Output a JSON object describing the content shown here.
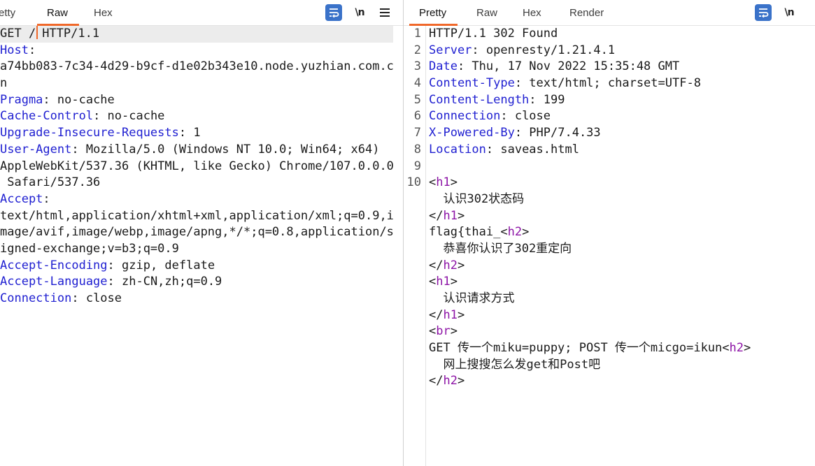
{
  "request": {
    "tabs": [
      "Pretty",
      "Raw",
      "Hex"
    ],
    "active_tab": "Raw",
    "tools": {
      "newline_label": "\\n"
    },
    "request_line": {
      "method": "GET /",
      "rest": "HTTP/1.1"
    },
    "lines": [
      {
        "k": "Host",
        "v": ":"
      },
      {
        "k": "",
        "v": "a74bb083-7c34-4d29-b9cf-d1e02b343e10.node.yuzhian.com.c"
      },
      {
        "k": "",
        "v": "n"
      },
      {
        "k": "Pragma",
        "v": ": no-cache"
      },
      {
        "k": "Cache-Control",
        "v": ": no-cache"
      },
      {
        "k": "Upgrade-Insecure-Requests",
        "v": ": 1"
      },
      {
        "k": "User-Agent",
        "v": ": Mozilla/5.0 (Windows NT 10.0; Win64; x64)"
      },
      {
        "k": "",
        "v": "AppleWebKit/537.36 (KHTML, like Gecko) Chrome/107.0.0.0"
      },
      {
        "k": "",
        "v": " Safari/537.36"
      },
      {
        "k": "Accept",
        "v": ":"
      },
      {
        "k": "",
        "v": "text/html,application/xhtml+xml,application/xml;q=0.9,i"
      },
      {
        "k": "",
        "v": "mage/avif,image/webp,image/apng,*/*;q=0.8,application/s"
      },
      {
        "k": "",
        "v": "igned-exchange;v=b3;q=0.9"
      },
      {
        "k": "Accept-Encoding",
        "v": ": gzip, deflate"
      },
      {
        "k": "Accept-Language",
        "v": ": zh-CN,zh;q=0.9"
      },
      {
        "k": "Connection",
        "v": ": close"
      }
    ]
  },
  "response": {
    "tabs": [
      "Pretty",
      "Raw",
      "Hex",
      "Render"
    ],
    "active_tab": "Pretty",
    "tools": {
      "newline_label": "\\n"
    },
    "line_numbers": [
      "1",
      "2",
      "3",
      "4",
      "5",
      "6",
      "7",
      "8",
      "9",
      "10"
    ],
    "lines": [
      [
        {
          "c": "",
          "s": "HTTP/1.1 302 Found"
        }
      ],
      [
        {
          "c": "k",
          "s": "Server"
        },
        {
          "c": "",
          "s": ": openresty/1.21.4.1"
        }
      ],
      [
        {
          "c": "k",
          "s": "Date"
        },
        {
          "c": "",
          "s": ": Thu, 17 Nov 2022 15:35:48 GMT"
        }
      ],
      [
        {
          "c": "k",
          "s": "Content-Type"
        },
        {
          "c": "",
          "s": ": text/html; charset=UTF-8"
        }
      ],
      [
        {
          "c": "k",
          "s": "Content-Length"
        },
        {
          "c": "",
          "s": ": 199"
        }
      ],
      [
        {
          "c": "k",
          "s": "Connection"
        },
        {
          "c": "",
          "s": ": close"
        }
      ],
      [
        {
          "c": "k",
          "s": "X-Powered-By"
        },
        {
          "c": "",
          "s": ": PHP/7.4.33"
        }
      ],
      [
        {
          "c": "k",
          "s": "Location"
        },
        {
          "c": "",
          "s": ": saveas.html"
        }
      ],
      [
        {
          "c": "",
          "s": ""
        }
      ],
      [
        {
          "c": "",
          "s": "<"
        },
        {
          "c": "t",
          "s": "h1"
        },
        {
          "c": "",
          "s": ">"
        }
      ],
      [
        {
          "c": "",
          "s": "  认识302状态码"
        }
      ],
      [
        {
          "c": "",
          "s": "</"
        },
        {
          "c": "t",
          "s": "h1"
        },
        {
          "c": "",
          "s": ">"
        }
      ],
      [
        {
          "c": "",
          "s": "flag{thai_<"
        },
        {
          "c": "t",
          "s": "h2"
        },
        {
          "c": "",
          "s": ">"
        }
      ],
      [
        {
          "c": "",
          "s": "  恭喜你认识了302重定向"
        }
      ],
      [
        {
          "c": "",
          "s": "</"
        },
        {
          "c": "t",
          "s": "h2"
        },
        {
          "c": "",
          "s": ">"
        }
      ],
      [
        {
          "c": "",
          "s": "<"
        },
        {
          "c": "t",
          "s": "h1"
        },
        {
          "c": "",
          "s": ">"
        }
      ],
      [
        {
          "c": "",
          "s": "  认识请求方式"
        }
      ],
      [
        {
          "c": "",
          "s": "</"
        },
        {
          "c": "t",
          "s": "h1"
        },
        {
          "c": "",
          "s": ">"
        }
      ],
      [
        {
          "c": "",
          "s": "<"
        },
        {
          "c": "t",
          "s": "br"
        },
        {
          "c": "",
          "s": ">"
        }
      ],
      [
        {
          "c": "",
          "s": "GET 传一个miku=puppy; POST 传一个micgo=ikun<"
        },
        {
          "c": "t",
          "s": "h2"
        },
        {
          "c": "",
          "s": ">"
        }
      ],
      [
        {
          "c": "",
          "s": "  网上搜搜怎么发get和Post吧"
        }
      ],
      [
        {
          "c": "",
          "s": "</"
        },
        {
          "c": "t",
          "s": "h2"
        },
        {
          "c": "",
          "s": ">"
        }
      ]
    ]
  },
  "colors": {
    "accent": "#f0682a",
    "header_key": "#1f1fd1",
    "tag_name": "#8d14a6",
    "wrap_button": "#3a72c9"
  }
}
